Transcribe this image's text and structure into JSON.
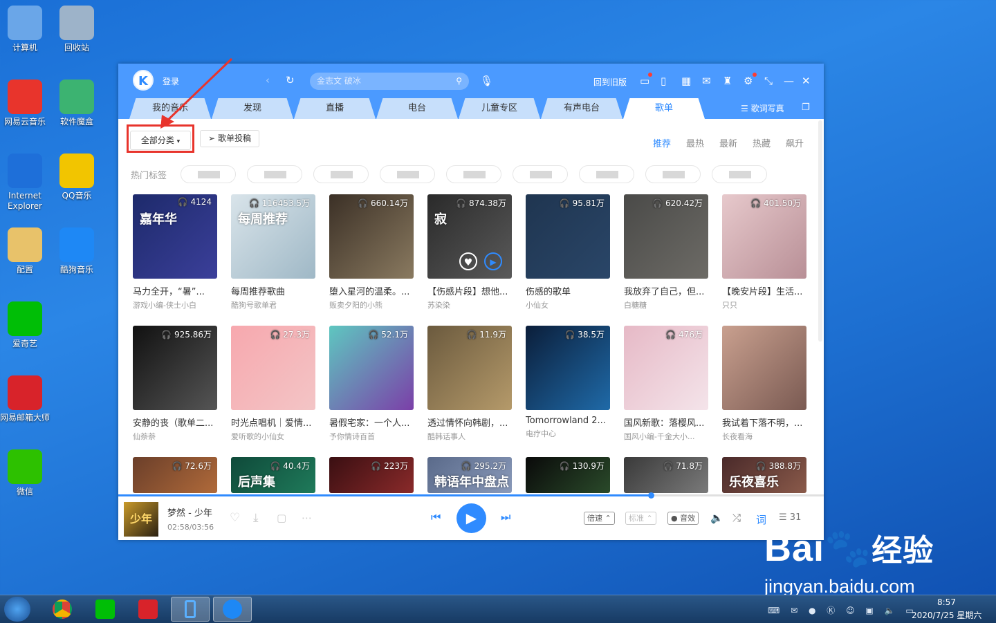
{
  "desktop": {
    "icons": [
      {
        "label": "计算机",
        "icon": "computer-icon"
      },
      {
        "label": "回收站",
        "icon": "recycle-bin-icon"
      },
      {
        "label": "网易云音乐",
        "icon": "netease-music-icon"
      },
      {
        "label": "软件魔盒",
        "icon": "software-box-icon"
      },
      {
        "label": "Internet Explorer",
        "icon": "ie-icon"
      },
      {
        "label": "QQ音乐",
        "icon": "qq-music-icon"
      },
      {
        "label": "配置",
        "icon": "folder-icon"
      },
      {
        "label": "酷狗音乐",
        "icon": "kugou-icon"
      },
      {
        "label": "爱奇艺",
        "icon": "iqiyi-icon"
      },
      {
        "label": "网易邮箱大师",
        "icon": "netease-mail-icon"
      },
      {
        "label": "微信",
        "icon": "wechat-icon"
      }
    ]
  },
  "app": {
    "logo": "K",
    "login": "登录",
    "search_placeholder": "金志文 破冰",
    "old_version": "回到旧版",
    "tabs": [
      "我的音乐",
      "发现",
      "直播",
      "电台",
      "儿童专区",
      "有声电台",
      "歌单"
    ],
    "active_tab": "歌单",
    "lyrics_poster": "歌词写真",
    "category_button": "全部分类",
    "submit_button": "歌单投稿",
    "sort_options": [
      "推荐",
      "最热",
      "最新",
      "热藏",
      "飙升"
    ],
    "active_sort": "推荐",
    "hot_tags_label": "热门标签",
    "playlists": [
      {
        "plays": "4124",
        "title": "马力全开，“暑”...",
        "author": "游戏小编-侠士小白",
        "cover": "嘉年华",
        "colors": [
          "#1d2a6b",
          "#3b3f9a"
        ]
      },
      {
        "plays": "116453.5万",
        "title": "每周推荐歌曲",
        "author": "酷狗号歌单君",
        "cover": "每周推荐",
        "colors": [
          "#d9e4ea",
          "#9fb8c6"
        ]
      },
      {
        "plays": "660.14万",
        "title": "堕入星河的温柔。...",
        "author": "贩卖夕阳的小熊",
        "cover": "",
        "colors": [
          "#3b3026",
          "#8a7a60"
        ]
      },
      {
        "plays": "874.38万",
        "title": "【伤感片段】想他...",
        "author": "苏染染",
        "cover": "寂",
        "colors": [
          "#2a2a2a",
          "#5a5a5a"
        ]
      },
      {
        "plays": "95.81万",
        "title": "伤感的歌单",
        "author": "小仙女",
        "cover": "",
        "colors": [
          "#1f3550",
          "#2a4668"
        ]
      },
      {
        "plays": "620.42万",
        "title": "我放弃了自己，但...",
        "author": "白糖糖",
        "cover": "",
        "colors": [
          "#4a4a48",
          "#6d6b66"
        ]
      },
      {
        "plays": "401.50万",
        "title": "【晚安片段】生活...",
        "author": "只只",
        "cover": "",
        "colors": [
          "#e7c9cc",
          "#b88f96"
        ]
      },
      {
        "plays": "925.86万",
        "title": "安静的丧（歌单二...",
        "author": "仙萘萘",
        "cover": "",
        "colors": [
          "#111111",
          "#555555"
        ]
      },
      {
        "plays": "27.3万",
        "title": "时光点唱机｜爱情...",
        "author": "爱听歌的小仙女",
        "cover": "",
        "colors": [
          "#f7a8ae",
          "#f3c5c6"
        ]
      },
      {
        "plays": "52.1万",
        "title": "暑假宅家：一个人...",
        "author": "予你情诗百首",
        "cover": "",
        "colors": [
          "#5ec7c0",
          "#7b3fa8"
        ]
      },
      {
        "plays": "11.9万",
        "title": "透过情怀向韩剧，...",
        "author": "酷韩话事人",
        "cover": "",
        "colors": [
          "#6b5a3e",
          "#b59a6a"
        ]
      },
      {
        "plays": "38.5万",
        "title": "Tomorrowland 2...",
        "author": "电疗中心",
        "cover": "",
        "colors": [
          "#0b1e3a",
          "#1f6aa8"
        ]
      },
      {
        "plays": "476万",
        "title": "国风新歌：落樱风...",
        "author": "国风小编-千金大小...",
        "cover": "",
        "colors": [
          "#e6b9c6",
          "#f4e4ea"
        ]
      },
      {
        "plays": "",
        "title": "我试着下落不明，...",
        "author": "长夜看海",
        "cover": "",
        "colors": [
          "#c9a08f",
          "#7a5a52"
        ]
      },
      {
        "plays": "72.6万",
        "title": "",
        "author": "",
        "cover": "",
        "colors": [
          "#6b3f2a",
          "#b06a3a"
        ]
      },
      {
        "plays": "40.4万",
        "title": "",
        "author": "",
        "cover": "后声集",
        "colors": [
          "#0f4a3a",
          "#1f7a5a"
        ]
      },
      {
        "plays": "223万",
        "title": "",
        "author": "",
        "cover": "",
        "colors": [
          "#3a0f12",
          "#8a2a2a"
        ]
      },
      {
        "plays": "295.2万",
        "title": "",
        "author": "",
        "cover": "韩语年中盘点",
        "colors": [
          "#5a6a8a",
          "#8a9aba"
        ]
      },
      {
        "plays": "130.9万",
        "title": "",
        "author": "",
        "cover": "",
        "colors": [
          "#0a0a0a",
          "#2a4a2a"
        ]
      },
      {
        "plays": "71.8万",
        "title": "",
        "author": "",
        "cover": "",
        "colors": [
          "#3a3a3a",
          "#7a7a7a"
        ]
      },
      {
        "plays": "388.8万",
        "title": "",
        "author": "",
        "cover": "乐夜喜乐",
        "colors": [
          "#4a2a2a",
          "#8a5a4a"
        ]
      }
    ],
    "player": {
      "song": "梦然 - 少年",
      "time": "02:58/03:56",
      "cover_text": "少年",
      "speed": "倍速",
      "quality": "标准",
      "effect": "音效",
      "lyric": "词",
      "queue_count": "31",
      "progress": 0.755
    }
  },
  "taskbar": {
    "clock_time": "8:57",
    "clock_date": "2020/7/25 星期六"
  },
  "watermark": {
    "brand": "Bai",
    "brand_cn": "经验",
    "url": "jingyan.baidu.com"
  },
  "colors": {
    "accent": "#2f8bff",
    "titlebar": "#4b9aff",
    "annotation": "#e8342c"
  }
}
